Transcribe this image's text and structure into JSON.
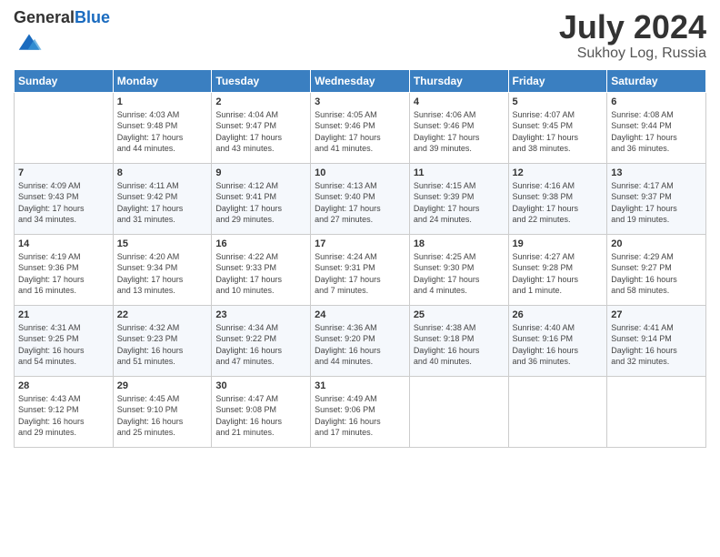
{
  "header": {
    "logo_general": "General",
    "logo_blue": "Blue",
    "month_title": "July 2024",
    "location": "Sukhoy Log, Russia"
  },
  "weekdays": [
    "Sunday",
    "Monday",
    "Tuesday",
    "Wednesday",
    "Thursday",
    "Friday",
    "Saturday"
  ],
  "weeks": [
    [
      {
        "day": "",
        "info": ""
      },
      {
        "day": "1",
        "info": "Sunrise: 4:03 AM\nSunset: 9:48 PM\nDaylight: 17 hours\nand 44 minutes."
      },
      {
        "day": "2",
        "info": "Sunrise: 4:04 AM\nSunset: 9:47 PM\nDaylight: 17 hours\nand 43 minutes."
      },
      {
        "day": "3",
        "info": "Sunrise: 4:05 AM\nSunset: 9:46 PM\nDaylight: 17 hours\nand 41 minutes."
      },
      {
        "day": "4",
        "info": "Sunrise: 4:06 AM\nSunset: 9:46 PM\nDaylight: 17 hours\nand 39 minutes."
      },
      {
        "day": "5",
        "info": "Sunrise: 4:07 AM\nSunset: 9:45 PM\nDaylight: 17 hours\nand 38 minutes."
      },
      {
        "day": "6",
        "info": "Sunrise: 4:08 AM\nSunset: 9:44 PM\nDaylight: 17 hours\nand 36 minutes."
      }
    ],
    [
      {
        "day": "7",
        "info": "Sunrise: 4:09 AM\nSunset: 9:43 PM\nDaylight: 17 hours\nand 34 minutes."
      },
      {
        "day": "8",
        "info": "Sunrise: 4:11 AM\nSunset: 9:42 PM\nDaylight: 17 hours\nand 31 minutes."
      },
      {
        "day": "9",
        "info": "Sunrise: 4:12 AM\nSunset: 9:41 PM\nDaylight: 17 hours\nand 29 minutes."
      },
      {
        "day": "10",
        "info": "Sunrise: 4:13 AM\nSunset: 9:40 PM\nDaylight: 17 hours\nand 27 minutes."
      },
      {
        "day": "11",
        "info": "Sunrise: 4:15 AM\nSunset: 9:39 PM\nDaylight: 17 hours\nand 24 minutes."
      },
      {
        "day": "12",
        "info": "Sunrise: 4:16 AM\nSunset: 9:38 PM\nDaylight: 17 hours\nand 22 minutes."
      },
      {
        "day": "13",
        "info": "Sunrise: 4:17 AM\nSunset: 9:37 PM\nDaylight: 17 hours\nand 19 minutes."
      }
    ],
    [
      {
        "day": "14",
        "info": "Sunrise: 4:19 AM\nSunset: 9:36 PM\nDaylight: 17 hours\nand 16 minutes."
      },
      {
        "day": "15",
        "info": "Sunrise: 4:20 AM\nSunset: 9:34 PM\nDaylight: 17 hours\nand 13 minutes."
      },
      {
        "day": "16",
        "info": "Sunrise: 4:22 AM\nSunset: 9:33 PM\nDaylight: 17 hours\nand 10 minutes."
      },
      {
        "day": "17",
        "info": "Sunrise: 4:24 AM\nSunset: 9:31 PM\nDaylight: 17 hours\nand 7 minutes."
      },
      {
        "day": "18",
        "info": "Sunrise: 4:25 AM\nSunset: 9:30 PM\nDaylight: 17 hours\nand 4 minutes."
      },
      {
        "day": "19",
        "info": "Sunrise: 4:27 AM\nSunset: 9:28 PM\nDaylight: 17 hours\nand 1 minute."
      },
      {
        "day": "20",
        "info": "Sunrise: 4:29 AM\nSunset: 9:27 PM\nDaylight: 16 hours\nand 58 minutes."
      }
    ],
    [
      {
        "day": "21",
        "info": "Sunrise: 4:31 AM\nSunset: 9:25 PM\nDaylight: 16 hours\nand 54 minutes."
      },
      {
        "day": "22",
        "info": "Sunrise: 4:32 AM\nSunset: 9:23 PM\nDaylight: 16 hours\nand 51 minutes."
      },
      {
        "day": "23",
        "info": "Sunrise: 4:34 AM\nSunset: 9:22 PM\nDaylight: 16 hours\nand 47 minutes."
      },
      {
        "day": "24",
        "info": "Sunrise: 4:36 AM\nSunset: 9:20 PM\nDaylight: 16 hours\nand 44 minutes."
      },
      {
        "day": "25",
        "info": "Sunrise: 4:38 AM\nSunset: 9:18 PM\nDaylight: 16 hours\nand 40 minutes."
      },
      {
        "day": "26",
        "info": "Sunrise: 4:40 AM\nSunset: 9:16 PM\nDaylight: 16 hours\nand 36 minutes."
      },
      {
        "day": "27",
        "info": "Sunrise: 4:41 AM\nSunset: 9:14 PM\nDaylight: 16 hours\nand 32 minutes."
      }
    ],
    [
      {
        "day": "28",
        "info": "Sunrise: 4:43 AM\nSunset: 9:12 PM\nDaylight: 16 hours\nand 29 minutes."
      },
      {
        "day": "29",
        "info": "Sunrise: 4:45 AM\nSunset: 9:10 PM\nDaylight: 16 hours\nand 25 minutes."
      },
      {
        "day": "30",
        "info": "Sunrise: 4:47 AM\nSunset: 9:08 PM\nDaylight: 16 hours\nand 21 minutes."
      },
      {
        "day": "31",
        "info": "Sunrise: 4:49 AM\nSunset: 9:06 PM\nDaylight: 16 hours\nand 17 minutes."
      },
      {
        "day": "",
        "info": ""
      },
      {
        "day": "",
        "info": ""
      },
      {
        "day": "",
        "info": ""
      }
    ]
  ]
}
